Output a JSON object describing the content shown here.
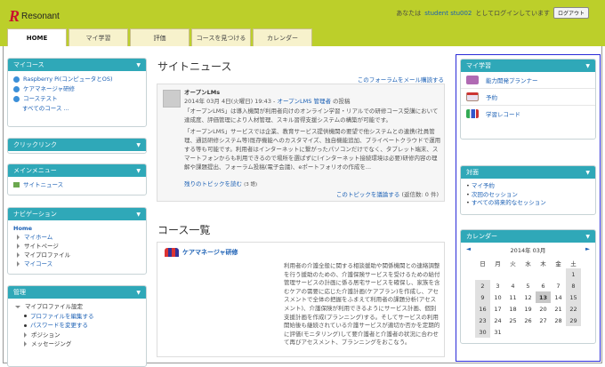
{
  "header": {
    "logo_mark": "R",
    "logo_text": "Resonant",
    "login_prefix": "あなたは",
    "user": "student stu002",
    "login_suffix": "としてログインしています",
    "logout": "ログアウト"
  },
  "tabs": [
    "HOME",
    "マイ学習",
    "評価",
    "コースを見つける",
    "カレンダー"
  ],
  "mycourses": {
    "title": "マイコース",
    "items": [
      "Raspberry Pi(コンピュータとOS)",
      "ケアマネージャ研修",
      "コーステスト"
    ],
    "all": "すべてのコース ..."
  },
  "clicklink": {
    "title": "クリックリンク"
  },
  "mainmenu": {
    "title": "メインメニュー",
    "items": [
      "サイトニュース"
    ]
  },
  "navigation": {
    "title": "ナビゲーション",
    "home": "Home",
    "items": [
      "マイホーム",
      "サイトページ",
      "マイプロファイル",
      "マイコース"
    ]
  },
  "admin": {
    "title": "管理",
    "profile": "マイプロファイル設定",
    "items": [
      "プロファイルを編集する",
      "パスワードを変更する",
      "ポジション",
      "メッセージング"
    ]
  },
  "news": {
    "title": "サイトニュース",
    "subscribe": "このフォーラムをメール購読する",
    "author": "オープンLMs",
    "meta_prefix": "2014年 03月 4日(火曜日) 19:43 - ",
    "meta_author": "オープンLMS 管理者",
    "meta_suffix": " の投稿",
    "p1": "「オープンLMS」は導入機関が利用者向けのオンライン学習・リアルでの研修コース受講において達成度、評価管理により人材管理、スキル習得支援システムの構築が可能です。",
    "p2": "「オープンLMS」サービスでは企業、教育サービス提供機関の要望で他システムとの連携(社員管理、通話研修システム等)既存機能へのカスタマイズ、独自機能追加、プライベートクラウドで運用する等も可能です。利用者はインターネットに繋がったパソコンだけでなく、タブレット端末、スマートフォンからも利用できるので場所を選ばずに(インターネット接続環境は必要)研修内容の理解や課題提出、フォーラム投稿(電子会議)、eポートフォリオの作成を...",
    "more": "残りのトピックを読む",
    "more_count": "(3 語)",
    "discuss": "このトピックを議論する",
    "replies": "(返信数: 0 件)"
  },
  "courses": {
    "title": "コース一覧",
    "course_name": "ケアマネージャ研修",
    "desc": "利用者の介護全般に関する相談援助や関係機関との連絡調整を行う援助のための、介護保険サービスを受けるための給付管理サービスの計画に係る居宅サービスを確保し、家族を含むケアの需要に応じた介護計画(ケアプラン)を作成し、アセスメントで全体の把握をふまえて利用者の課題分析(アセスメント)、介護保険が利用できるようにサービス計画、個別支援計画を作成(プランニング)する。そしてサービスの利用開始後も継続されている介護サービスが適切か否かを定期的に評価(モニタリング)して要介護者と介護者の状況に合わせて再びアセスメント、プランニングをおこなう。"
  },
  "mylearning": {
    "title": "マイ学習",
    "items": [
      "能力開発プランナー",
      "予約",
      "学習レコード"
    ]
  },
  "faceto": {
    "title": "対面",
    "items": [
      "マイ予約",
      "次回のセッション",
      "すべての将来的なセッション"
    ]
  },
  "calendar": {
    "title": "カレンダー",
    "prev": "◄",
    "next": "►",
    "month": "2014年 03月",
    "days": [
      "日",
      "月",
      "火",
      "水",
      "木",
      "金",
      "土"
    ],
    "weeks": [
      [
        "",
        "",
        "",
        "",
        "",
        "",
        "1"
      ],
      [
        "2",
        "3",
        "4",
        "5",
        "6",
        "7",
        "8"
      ],
      [
        "9",
        "10",
        "11",
        "12",
        "13",
        "14",
        "15"
      ],
      [
        "16",
        "17",
        "18",
        "19",
        "20",
        "21",
        "22"
      ],
      [
        "23",
        "24",
        "25",
        "26",
        "27",
        "28",
        "29"
      ],
      [
        "30",
        "31",
        "",
        "",
        "",
        "",
        ""
      ]
    ],
    "today": "13"
  },
  "colors": {
    "topbar": "#bccf2a",
    "block_header": "#2fa8b8",
    "link": "#1a5fb4"
  }
}
